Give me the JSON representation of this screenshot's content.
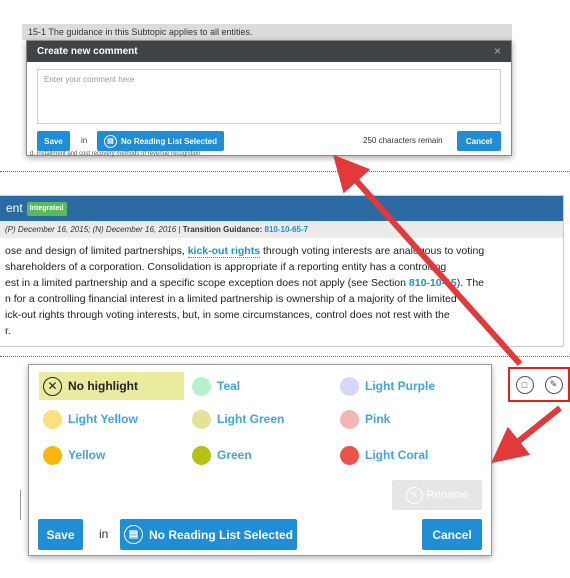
{
  "guidance_top": "15-1  The guidance in this Subtopic applies to all entities.",
  "comment_dialog": {
    "title": "Create new comment",
    "close_glyph": "×",
    "placeholder": "Enter your comment here",
    "save_label": "Save",
    "in_label": "in",
    "reading_list_label": "No Reading List Selected",
    "chars_remaining": "250 characters remain",
    "cancel_label": "Cancel"
  },
  "partial_text": "d.  Installment and cost recovery methods of revenue recognition",
  "content": {
    "header_text": "ent",
    "badge": "Integrated",
    "meta_prefix": "(P) December 16, 2015; (N) December 16, 2016 | ",
    "meta_bold": "Transition Guidance:",
    "meta_link": "810-10-65-7",
    "line1_a": "ose and design of limited partnerships, ",
    "line1_link": "kick-out rights",
    "line1_b": " through voting interests are analogous to voting",
    "line2": "shareholders of a corporation. Consolidation is appropriate if a reporting entity has a controlling",
    "line3_a": "est in a limited partnership and a specific scope exception does not apply (see Section ",
    "line3_link": "810-10-15",
    "line3_b": "). The",
    "line4": "n for a controlling financial interest in a limited partnership is ownership of a majority of the limited",
    "line5": "ick-out rights through voting interests, but, in some circumstances, control does not rest with the",
    "line6": "r."
  },
  "highlight_panel": {
    "options": [
      {
        "label": "No highlight",
        "color": ""
      },
      {
        "label": "Teal",
        "color": "#b7f0d0"
      },
      {
        "label": "Light Purple",
        "color": "#d9d7f7"
      },
      {
        "label": "Light Yellow",
        "color": "#fbe07c"
      },
      {
        "label": "Light Green",
        "color": "#e2e29a"
      },
      {
        "label": "Pink",
        "color": "#f5b7b3"
      },
      {
        "label": "Yellow",
        "color": "#fbb70f"
      },
      {
        "label": "Green",
        "color": "#b4c215"
      },
      {
        "label": "Light Coral",
        "color": "#e8534a"
      }
    ],
    "rename_label": "Rename",
    "save_label": "Save",
    "in_label": "in",
    "reading_list_label": "No Reading List Selected",
    "cancel_label": "Cancel"
  },
  "colors": {
    "accent_blue": "#1f8ed6",
    "header_blue": "#2b6aa3",
    "annotation_red": "#e03a3a"
  },
  "icons": [
    "close-icon",
    "reading-list-icon",
    "comment-icon",
    "highlight-pen-icon",
    "no-highlight-icon",
    "rename-pen-icon"
  ]
}
